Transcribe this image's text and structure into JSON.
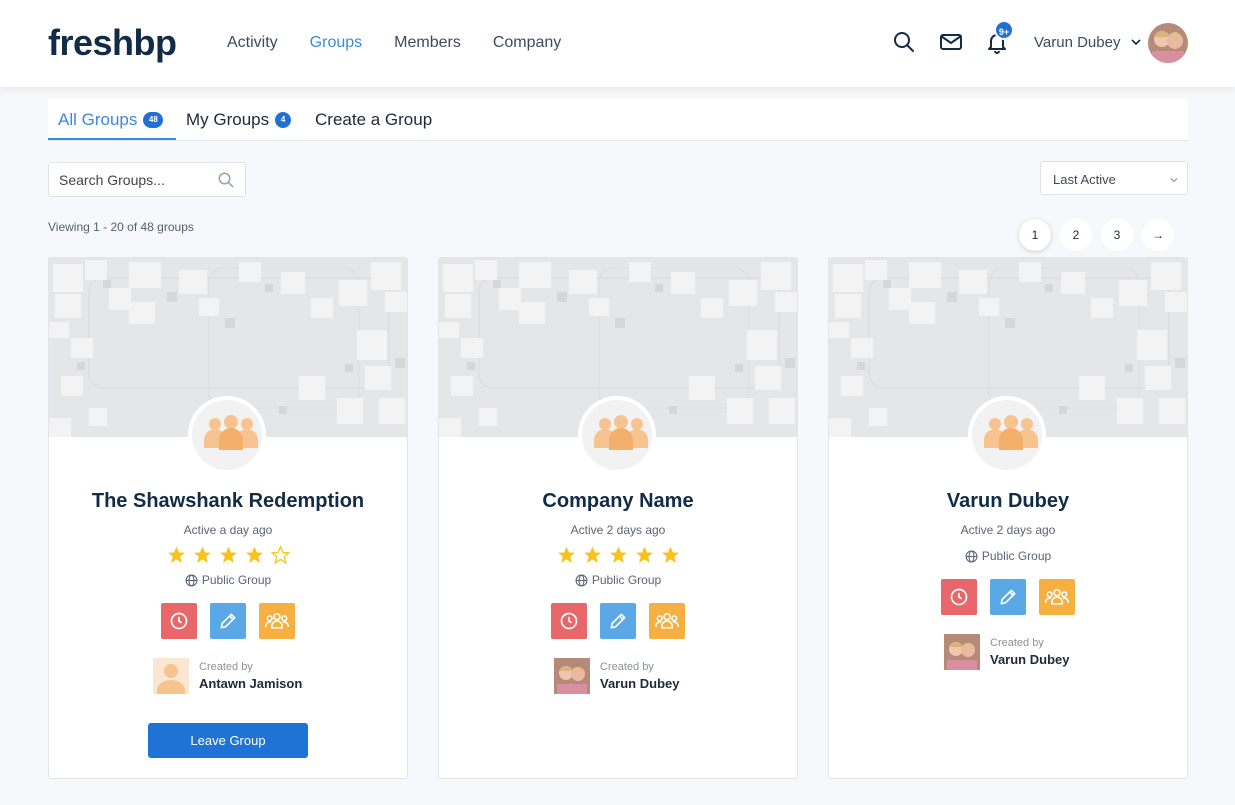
{
  "header": {
    "logo": "freshbp",
    "nav": [
      "Activity",
      "Groups",
      "Members",
      "Company"
    ],
    "active_nav": "Groups",
    "notification_count": "9+",
    "user_name": "Varun Dubey"
  },
  "tabs": [
    {
      "label": "All Groups",
      "badge": "48"
    },
    {
      "label": "My Groups",
      "badge": "4"
    },
    {
      "label": "Create a Group"
    }
  ],
  "search": {
    "placeholder": "Search Groups..."
  },
  "sort": {
    "selected": "Last Active"
  },
  "viewing": "Viewing 1 - 20 of 48 groups",
  "pagination": {
    "pages": [
      "1",
      "2",
      "3"
    ],
    "current": "1",
    "next": "→"
  },
  "colors": {
    "accent": "#3b8ad9",
    "button": "#1f73d6",
    "star": "#f7c21c",
    "action_red": "#e8676b",
    "action_blue": "#5aa8e5",
    "action_orange": "#f5b041"
  },
  "groups": [
    {
      "title": "The Shawshank Redemption",
      "active": "Active a day ago",
      "rating": 4,
      "type": "Public Group",
      "created_by_label": "Created by",
      "creator": "Antawn Jamison",
      "leave_label": "Leave Group"
    },
    {
      "title": "Company Name",
      "active": "Active 2 days ago",
      "rating": 5,
      "type": "Public Group",
      "created_by_label": "Created by",
      "creator": "Varun Dubey"
    },
    {
      "title": "Varun Dubey",
      "active": "Active 2 days ago",
      "type": "Public Group",
      "created_by_label": "Created by",
      "creator": "Varun Dubey"
    }
  ]
}
